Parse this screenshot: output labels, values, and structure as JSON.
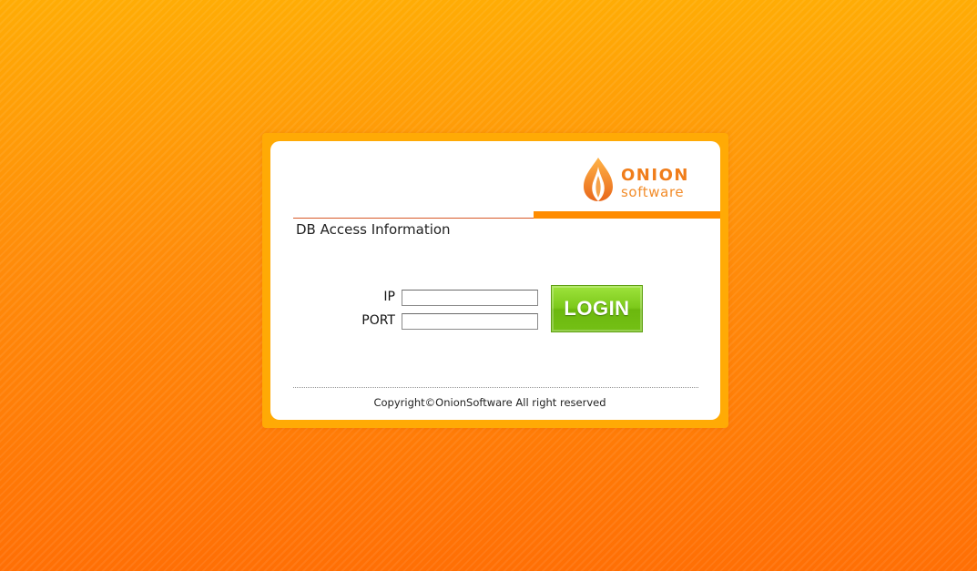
{
  "brand": {
    "name_line1": "ONION",
    "name_line2": "software",
    "accent_color": "#ff8c00"
  },
  "section": {
    "title": "DB Access Information"
  },
  "form": {
    "ip_label": "IP",
    "ip_value": "",
    "port_label": "PORT",
    "port_value": "",
    "login_label": "LOGIN"
  },
  "footer": {
    "copyright": "Copyright©OnionSoftware All right reserved"
  }
}
